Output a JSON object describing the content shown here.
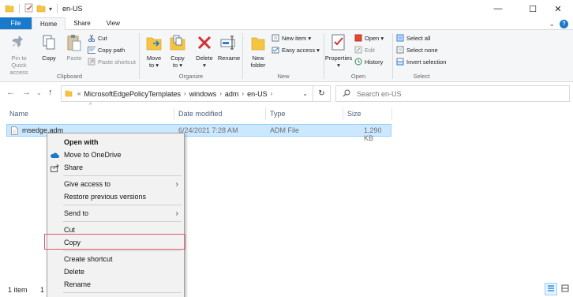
{
  "window": {
    "title": "en-US",
    "minimize_glyph": "—",
    "maximize_glyph": "☐",
    "close_glyph": "✕"
  },
  "ribbon_tabs": [
    {
      "label": "File"
    },
    {
      "label": "Home"
    },
    {
      "label": "Share"
    },
    {
      "label": "View"
    }
  ],
  "ribbon": {
    "clipboard": {
      "label": "Clipboard",
      "pin": "Pin to Quick access",
      "pin_line1": "Pin to Quick",
      "pin_line2": "access",
      "copy": "Copy",
      "paste": "Paste",
      "cut": "Cut",
      "copy_path": "Copy path",
      "paste_shortcut": "Paste shortcut"
    },
    "organize": {
      "label": "Organize",
      "move_to_1": "Move",
      "move_to_2": "to ▾",
      "copy_to_1": "Copy",
      "copy_to_2": "to ▾",
      "delete_1": "Delete",
      "delete_2": "▾",
      "rename": "Rename"
    },
    "new": {
      "label": "New",
      "new_folder_1": "New",
      "new_folder_2": "folder",
      "new_item": "New item ▾",
      "easy_access": "Easy access ▾"
    },
    "open": {
      "label": "Open",
      "properties_1": "Properties",
      "properties_2": "▾",
      "open": "Open ▾",
      "edit": "Edit",
      "history": "History"
    },
    "select": {
      "label": "Select",
      "select_all": "Select all",
      "select_none": "Select none",
      "invert": "Invert selection"
    }
  },
  "address": {
    "crumbs": [
      "MicrosoftEdgePolicyTemplates",
      "windows",
      "adm",
      "en-US"
    ],
    "search_placeholder": "Search en-US"
  },
  "columns": {
    "name": "Name",
    "date_modified": "Date modified",
    "type": "Type",
    "size": "Size"
  },
  "files": [
    {
      "name": "msedge.adm",
      "date_modified": "6/24/2021 7:28 AM",
      "type": "ADM File",
      "size": "1,290 KB"
    }
  ],
  "context_menu": {
    "open_with": "Open with",
    "move_to_onedrive": "Move to OneDrive",
    "share": "Share",
    "give_access_to": "Give access to",
    "restore_previous": "Restore previous versions",
    "send_to": "Send to",
    "cut": "Cut",
    "copy": "Copy",
    "create_shortcut": "Create shortcut",
    "delete": "Delete",
    "rename": "Rename"
  },
  "status": {
    "item_count": "1 item",
    "selected_partial": "1"
  },
  "colors": {
    "accent": "#1979ca",
    "selection": "#cce8ff",
    "highlight_box": "#e05a6e",
    "delete_red": "#d13438"
  }
}
